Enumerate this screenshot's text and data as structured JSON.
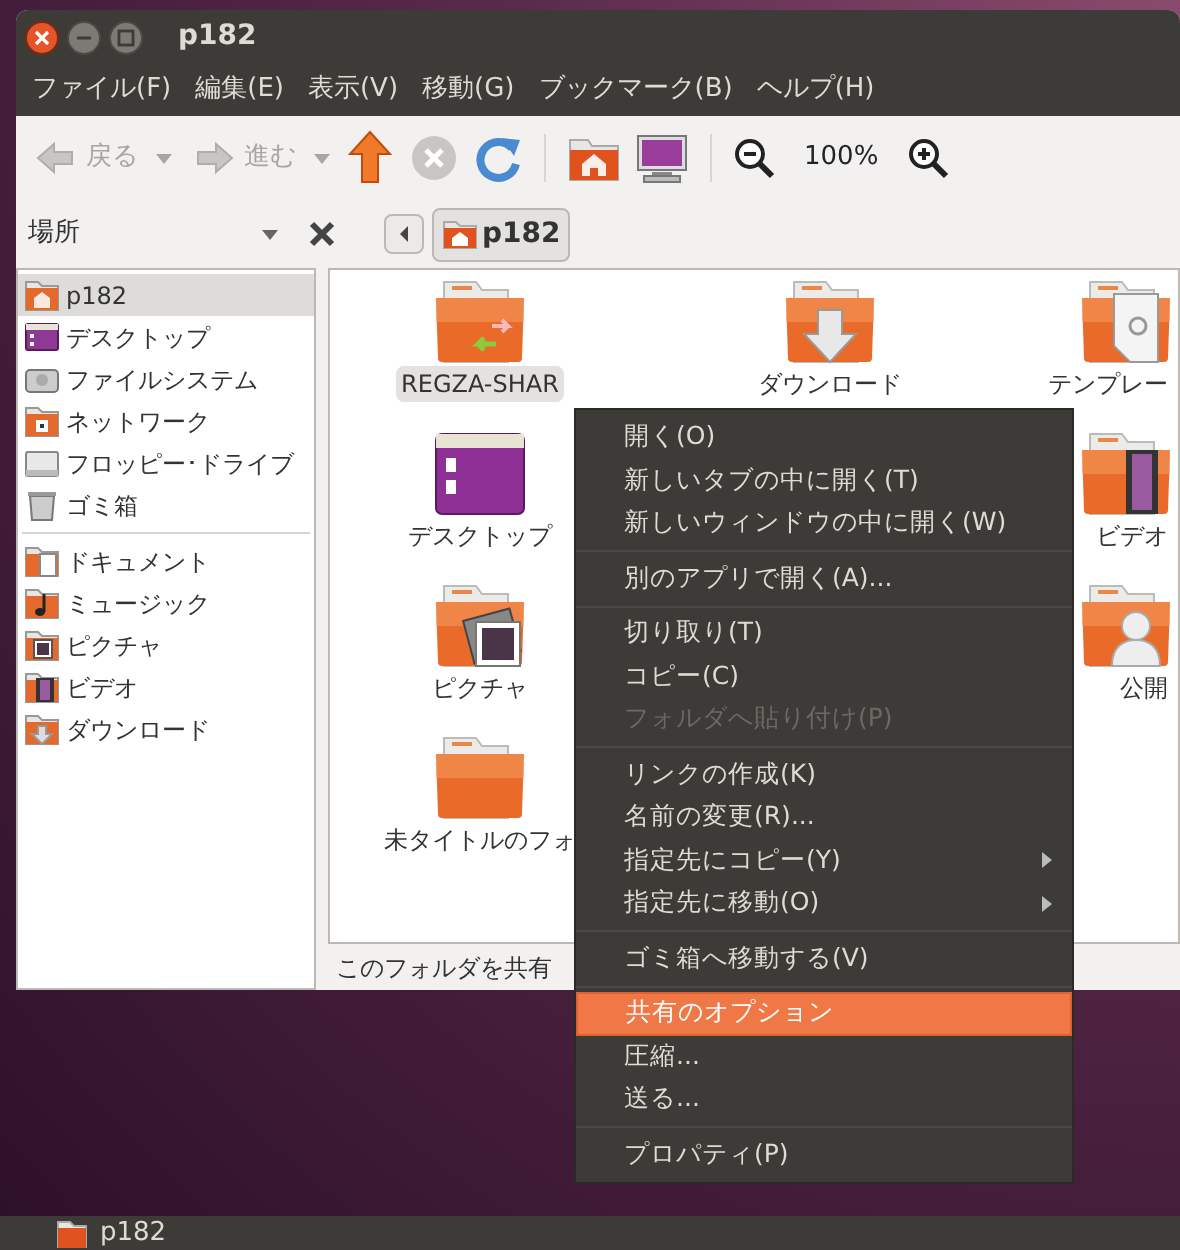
{
  "window": {
    "title": "p182"
  },
  "menubar": [
    "ファイル(F)",
    "編集(E)",
    "表示(V)",
    "移動(G)",
    "ブックマーク(B)",
    "ヘルプ(H)"
  ],
  "toolbar": {
    "back": {
      "label": "戻る",
      "disabled": true
    },
    "forward": {
      "label": "進む",
      "disabled": true
    },
    "stop": {
      "disabled": true
    },
    "zoom": "100%"
  },
  "location": {
    "label": "場所",
    "path": [
      {
        "label": "p182",
        "selected": true
      }
    ]
  },
  "sidebar": {
    "groups": [
      {
        "items": [
          {
            "label": "p182",
            "kind": "home",
            "selected": true
          },
          {
            "label": "デスクトップ",
            "kind": "desktop",
            "selected": false
          },
          {
            "label": "ファイルシステム",
            "kind": "drive",
            "selected": false
          },
          {
            "label": "ネットワーク",
            "kind": "network",
            "selected": false
          },
          {
            "label": "フロッピー･ドライブ",
            "kind": "floppy",
            "selected": false
          },
          {
            "label": "ゴミ箱",
            "kind": "trash",
            "selected": false
          }
        ]
      },
      {
        "items": [
          {
            "label": "ドキュメント",
            "kind": "documents",
            "selected": false
          },
          {
            "label": "ミュージック",
            "kind": "music",
            "selected": false
          },
          {
            "label": "ピクチャ",
            "kind": "pictures",
            "selected": false
          },
          {
            "label": "ビデオ",
            "kind": "video",
            "selected": false
          },
          {
            "label": "ダウンロード",
            "kind": "download",
            "selected": false
          }
        ]
      }
    ]
  },
  "file_columns": [
    [
      {
        "label": "REGZA-SHAR",
        "kind": "shared",
        "selected": true
      },
      {
        "label": "デスクトップ",
        "kind": "desktop",
        "selected": false
      },
      {
        "label": "ピクチャ",
        "kind": "pictures",
        "selected": false
      },
      {
        "label": "未タイトルのフォ",
        "kind": "folder",
        "selected": false
      }
    ],
    [
      {
        "label": "ダウンロード",
        "kind": "download",
        "selected": false
      }
    ],
    [
      {
        "label": "テンプレー",
        "kind": "template",
        "selected": false
      },
      {
        "label": "ビデオ",
        "kind": "video",
        "selected": false
      },
      {
        "label": "公開",
        "kind": "public",
        "selected": false
      }
    ]
  ],
  "status_bar": "このフォルダを共有",
  "context_menu": [
    {
      "kind": "item",
      "label": "開く(O)",
      "disabled": false,
      "submenu": false,
      "selected": false
    },
    {
      "kind": "item",
      "label": "新しいタブの中に開く(T)",
      "disabled": false,
      "submenu": false,
      "selected": false
    },
    {
      "kind": "item",
      "label": "新しいウィンドウの中に開く(W)",
      "disabled": false,
      "submenu": false,
      "selected": false
    },
    {
      "kind": "separator"
    },
    {
      "kind": "item",
      "label": "別のアプリで開く(A)...",
      "disabled": false,
      "submenu": false,
      "selected": false
    },
    {
      "kind": "separator"
    },
    {
      "kind": "item",
      "label": "切り取り(T)",
      "disabled": false,
      "submenu": false,
      "selected": false
    },
    {
      "kind": "item",
      "label": "コピー(C)",
      "disabled": false,
      "submenu": false,
      "selected": false
    },
    {
      "kind": "item",
      "label": "フォルダへ貼り付け(P)",
      "disabled": true,
      "submenu": false,
      "selected": false
    },
    {
      "kind": "separator"
    },
    {
      "kind": "item",
      "label": "リンクの作成(K)",
      "disabled": false,
      "submenu": false,
      "selected": false
    },
    {
      "kind": "item",
      "label": "名前の変更(R)...",
      "disabled": false,
      "submenu": false,
      "selected": false
    },
    {
      "kind": "item",
      "label": "指定先にコピー(Y)",
      "disabled": false,
      "submenu": true,
      "selected": false
    },
    {
      "kind": "item",
      "label": "指定先に移動(O)",
      "disabled": false,
      "submenu": true,
      "selected": false
    },
    {
      "kind": "separator"
    },
    {
      "kind": "item",
      "label": "ゴミ箱へ移動する(V)",
      "disabled": false,
      "submenu": false,
      "selected": false
    },
    {
      "kind": "separator"
    },
    {
      "kind": "item",
      "label": "共有のオプション",
      "disabled": false,
      "submenu": false,
      "selected": true
    },
    {
      "kind": "item",
      "label": "圧縮...",
      "disabled": false,
      "submenu": false,
      "selected": false
    },
    {
      "kind": "item",
      "label": "送る...",
      "disabled": false,
      "submenu": false,
      "selected": false
    },
    {
      "kind": "separator"
    },
    {
      "kind": "item",
      "label": "プロパティ(P)",
      "disabled": false,
      "submenu": false,
      "selected": false
    }
  ],
  "taskbar": {
    "label": "p182"
  }
}
